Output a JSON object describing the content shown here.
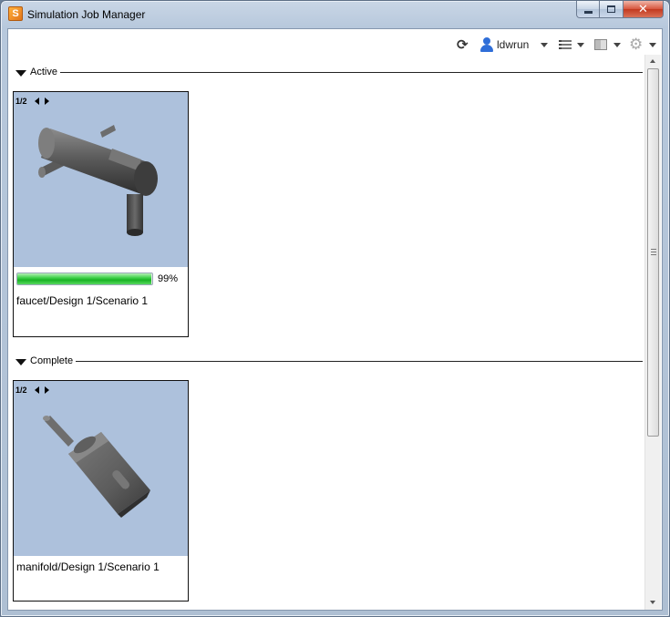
{
  "window": {
    "title": "Simulation Job Manager",
    "close_glyph": "✕"
  },
  "toolbar": {
    "refresh_glyph": "⟳",
    "user": "ldwrun",
    "gear_glyph": "⚙"
  },
  "sections": {
    "active": {
      "label": "Active",
      "jobs": [
        {
          "pager": "1/2",
          "progress": 0.99,
          "progress_label": "99%",
          "name": "faucet/Design 1/Scenario 1"
        }
      ]
    },
    "complete": {
      "label": "Complete",
      "jobs": [
        {
          "pager": "1/2",
          "name": "manifold/Design 1/Scenario 1"
        }
      ]
    }
  },
  "icons": {
    "app": "app-icon",
    "refresh": "refresh-icon",
    "user": "user-icon",
    "list_view": "list-view-icon",
    "layout": "layout-icon",
    "settings": "gear-icon"
  },
  "colors": {
    "thumbnail_bg": "#adc1dc",
    "progress": "#19b324"
  }
}
